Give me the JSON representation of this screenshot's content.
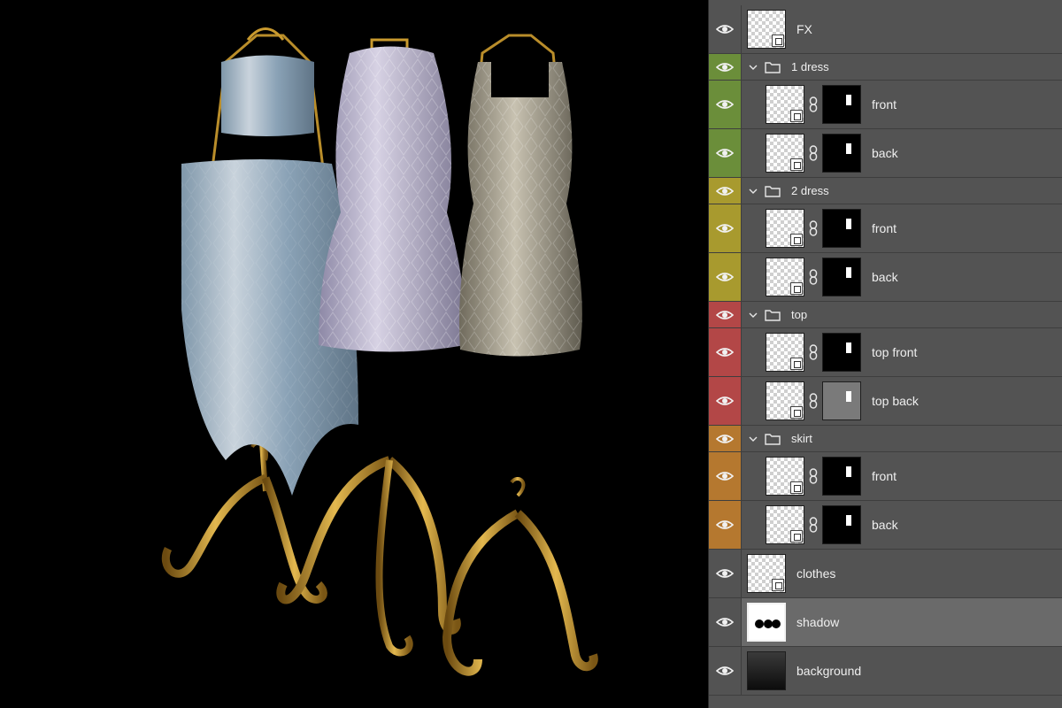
{
  "canvas": {
    "mannequins": [
      "mannequin-left",
      "mannequin-middle",
      "mannequin-right"
    ]
  },
  "layers": [
    {
      "type": "layer",
      "name": "FX",
      "eye": "#535353",
      "icon": "eye-icon"
    },
    {
      "type": "group",
      "name": "1 dress",
      "eye": "#6b8e3a",
      "icon": "folder-icon"
    },
    {
      "type": "layer",
      "name": "front",
      "eye": "#6b8e3a",
      "mask": true
    },
    {
      "type": "layer",
      "name": "back",
      "eye": "#6b8e3a",
      "mask": true
    },
    {
      "type": "group",
      "name": "2 dress",
      "eye": "#a89a2e",
      "icon": "folder-icon"
    },
    {
      "type": "layer",
      "name": "front",
      "eye": "#a89a2e",
      "mask": true
    },
    {
      "type": "layer",
      "name": "back",
      "eye": "#a89a2e",
      "mask": true
    },
    {
      "type": "group",
      "name": "top",
      "eye": "#b34747",
      "icon": "folder-icon"
    },
    {
      "type": "layer",
      "name": "top front",
      "eye": "#b34747",
      "mask": true
    },
    {
      "type": "layer",
      "name": "top back",
      "eye": "#b34747",
      "mask": true,
      "mask_gray": true
    },
    {
      "type": "group",
      "name": "skirt",
      "eye": "#b5782f",
      "icon": "folder-icon"
    },
    {
      "type": "layer",
      "name": "front",
      "eye": "#b5782f",
      "mask": true
    },
    {
      "type": "layer",
      "name": "back",
      "eye": "#b5782f",
      "mask": true
    },
    {
      "type": "layer",
      "name": "clothes",
      "eye": "#535353"
    },
    {
      "type": "layer",
      "name": "shadow",
      "eye": "#535353",
      "selected": true
    },
    {
      "type": "layer",
      "name": "background",
      "eye": "#535353"
    }
  ],
  "colors": {
    "panel_bg": "#535353",
    "selected_bg": "#6a6a6a",
    "gold": "#c99a2e",
    "fabric_blue": "#9fb3c4",
    "fabric_lilac": "#c7c2d6",
    "fabric_gray": "#b6b1a3"
  }
}
